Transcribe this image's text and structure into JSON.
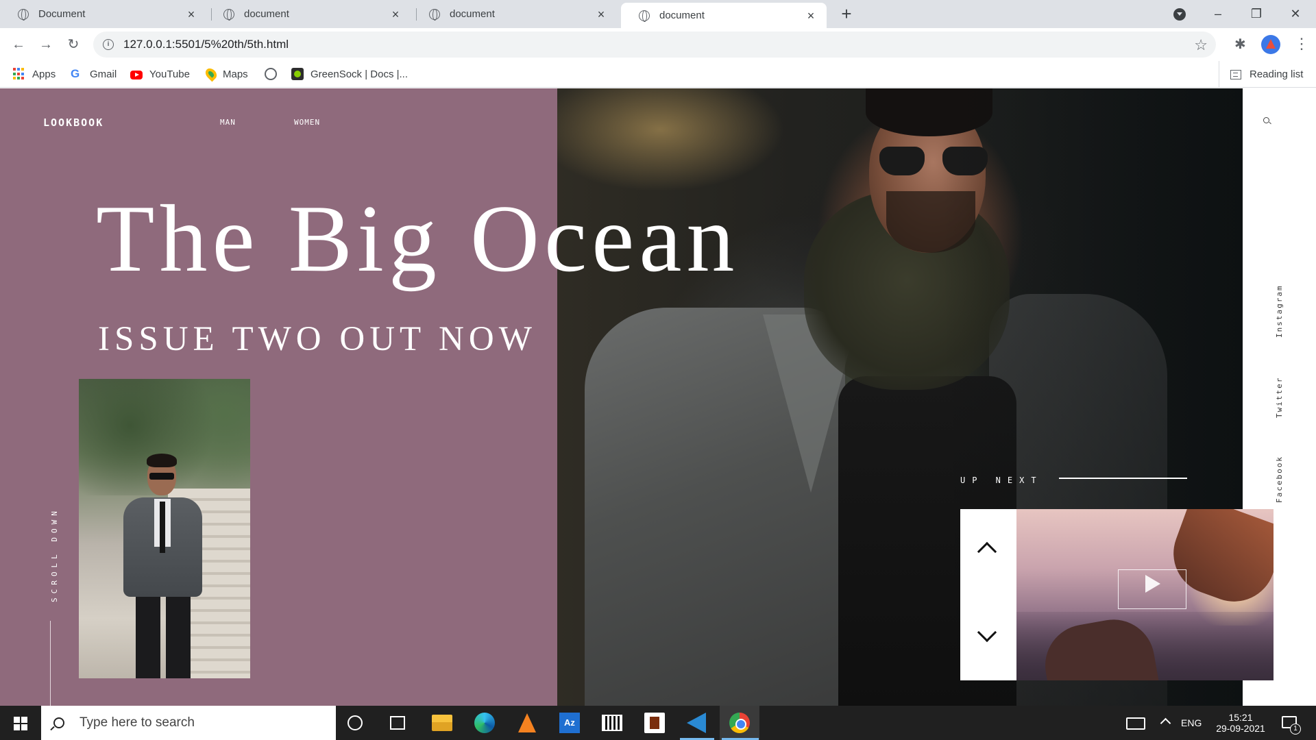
{
  "browser": {
    "tabs": [
      {
        "title": "Document",
        "active": false
      },
      {
        "title": "document",
        "active": false
      },
      {
        "title": "document",
        "active": false
      },
      {
        "title": "document",
        "active": true
      }
    ],
    "url": "127.0.0.1:5501/5%20th/5th.html",
    "bookmarks": [
      {
        "label": "Apps",
        "icon": "apps-grid-icon"
      },
      {
        "label": "Gmail",
        "icon": "google-icon"
      },
      {
        "label": "YouTube",
        "icon": "youtube-icon"
      },
      {
        "label": "Maps",
        "icon": "maps-pin-icon"
      },
      {
        "label": "",
        "icon": "globe-icon"
      },
      {
        "label": "GreenSock | Docs |...",
        "icon": "greensock-icon"
      }
    ],
    "reading_list": "Reading list"
  },
  "page": {
    "logo": "LOOKBOOK",
    "nav": [
      "MAN",
      "WOMEN"
    ],
    "headline": "The Big Ocean",
    "subheadline": "ISSUE TWO OUT NOW",
    "scroll_label": "SCROLL DOWN",
    "up_next": "UP NEXT",
    "social": [
      "Instagram",
      "Twitter",
      "Facebook"
    ],
    "colors": {
      "page_bg": "#8f6a7c",
      "sidebar_bg": "#ffffff",
      "text": "#ffffff"
    }
  },
  "taskbar": {
    "search_placeholder": "Type here to search",
    "language": "ENG",
    "time": "15:21",
    "date": "29-09-2021",
    "notification_count": "1"
  }
}
